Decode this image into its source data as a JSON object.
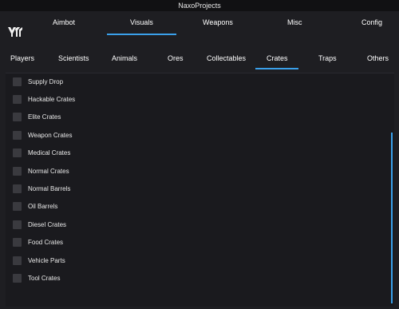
{
  "window": {
    "title": "NaxoProjects"
  },
  "logo": {
    "icon": "naxo-logo-icon"
  },
  "top_tabs": [
    {
      "label": "Aimbot"
    },
    {
      "label": "Visuals"
    },
    {
      "label": "Weapons"
    },
    {
      "label": "Misc"
    },
    {
      "label": "Config"
    }
  ],
  "top_active": "Visuals",
  "sub_tabs": [
    {
      "label": "Players"
    },
    {
      "label": "Scientists"
    },
    {
      "label": "Animals"
    },
    {
      "label": "Ores"
    },
    {
      "label": "Collectables"
    },
    {
      "label": "Crates"
    },
    {
      "label": "Traps"
    },
    {
      "label": "Others"
    }
  ],
  "sub_active": "Crates",
  "crates": {
    "items": [
      {
        "label": "Supply Drop",
        "checked": false
      },
      {
        "label": "Hackable Crates",
        "checked": false
      },
      {
        "label": "Elite Crates",
        "checked": false
      },
      {
        "label": "Weapon Crates",
        "checked": false
      },
      {
        "label": "Medical Crates",
        "checked": false
      },
      {
        "label": "Normal Crates",
        "checked": false
      },
      {
        "label": "Normal Barrels",
        "checked": false
      },
      {
        "label": "Oil Barrels",
        "checked": false
      },
      {
        "label": "Diesel Crates",
        "checked": false
      },
      {
        "label": "Food Crates",
        "checked": false
      },
      {
        "label": "Vehicle Parts",
        "checked": false
      },
      {
        "label": "Tool Crates",
        "checked": false
      }
    ]
  },
  "colors": {
    "accent": "#3aa0ea",
    "background": "#1e1e22",
    "checkbox": "#3a3a3f"
  }
}
